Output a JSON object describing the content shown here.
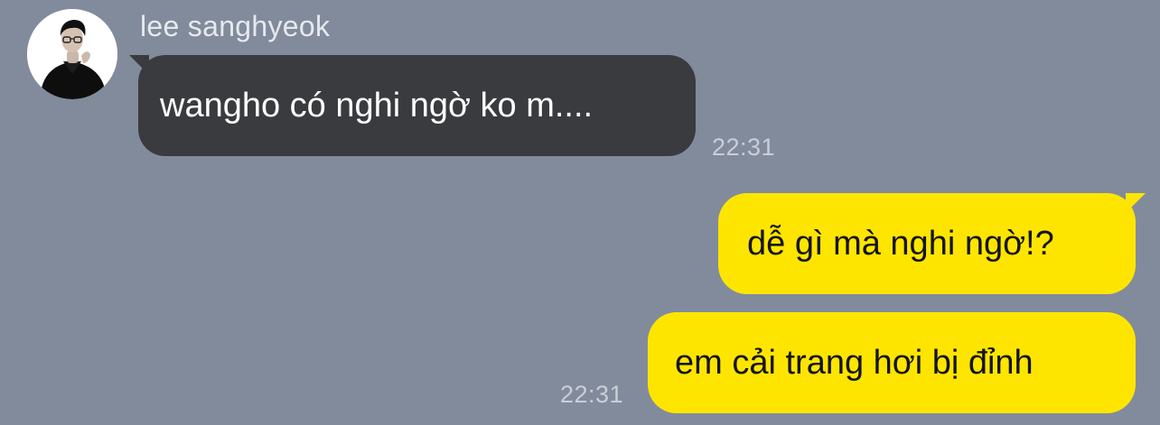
{
  "chat": {
    "sender_name": "lee sanghyeok",
    "messages": [
      {
        "direction": "incoming",
        "text": "wangho có nghi ngờ ko m....",
        "time": "22:31"
      },
      {
        "direction": "outgoing",
        "text": "dễ gì mà nghi ngờ!?"
      },
      {
        "direction": "outgoing",
        "text": "em cải trang hơi bị đỉnh",
        "time": "22:31"
      }
    ]
  },
  "colors": {
    "background": "#828b9c",
    "incoming_bubble": "#3a3b3f",
    "outgoing_bubble": "#fee500"
  },
  "icons": {
    "avatar": "profile-photo"
  }
}
